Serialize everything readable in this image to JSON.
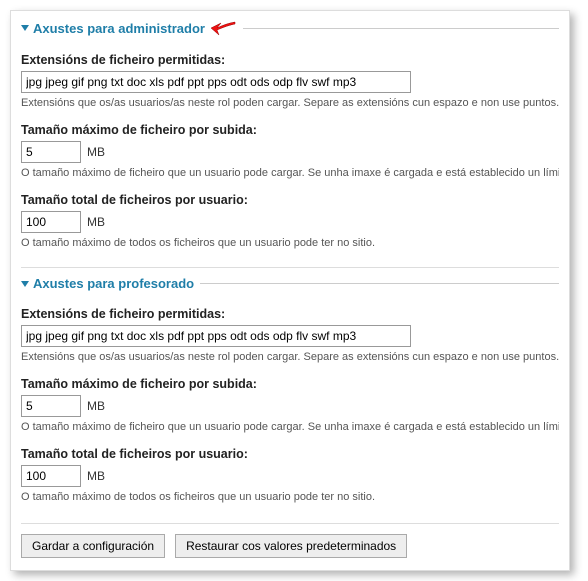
{
  "sections": [
    {
      "title": "Axustes para administrador",
      "has_arrow": true,
      "fields": {
        "ext_label": "Extensións de ficheiro permitidas:",
        "ext_value": "jpg jpeg gif png txt doc xls pdf ppt pps odt ods odp flv swf mp3",
        "ext_help": "Extensións que os/as usuarios/as neste rol poden cargar. Separe as extensións cun espazo e non use puntos.",
        "maxupload_label": "Tamaño máximo de ficheiro por subida:",
        "maxupload_value": "5",
        "maxupload_unit": "MB",
        "maxupload_help": "O tamaño máximo de ficheiro que un usuario pode cargar. Se unha imaxe é cargada e está establecido un límite menor...",
        "total_label": "Tamaño total de ficheiros por usuario:",
        "total_value": "100",
        "total_unit": "MB",
        "total_help": "O tamaño máximo de todos os ficheiros que un usuario pode ter no sitio."
      }
    },
    {
      "title": "Axustes para profesorado",
      "has_arrow": false,
      "fields": {
        "ext_label": "Extensións de ficheiro permitidas:",
        "ext_value": "jpg jpeg gif png txt doc xls pdf ppt pps odt ods odp flv swf mp3",
        "ext_help": "Extensións que os/as usuarios/as neste rol poden cargar. Separe as extensións cun espazo e non use puntos.",
        "maxupload_label": "Tamaño máximo de ficheiro por subida:",
        "maxupload_value": "5",
        "maxupload_unit": "MB",
        "maxupload_help": "O tamaño máximo de ficheiro que un usuario pode cargar. Se unha imaxe é cargada e está establecido un límite menor...",
        "total_label": "Tamaño total de ficheiros por usuario:",
        "total_value": "100",
        "total_unit": "MB",
        "total_help": "O tamaño máximo de todos os ficheiros que un usuario pode ter no sitio."
      }
    }
  ],
  "buttons": {
    "save": "Gardar a configuración",
    "restore": "Restaurar cos valores predeterminados"
  }
}
